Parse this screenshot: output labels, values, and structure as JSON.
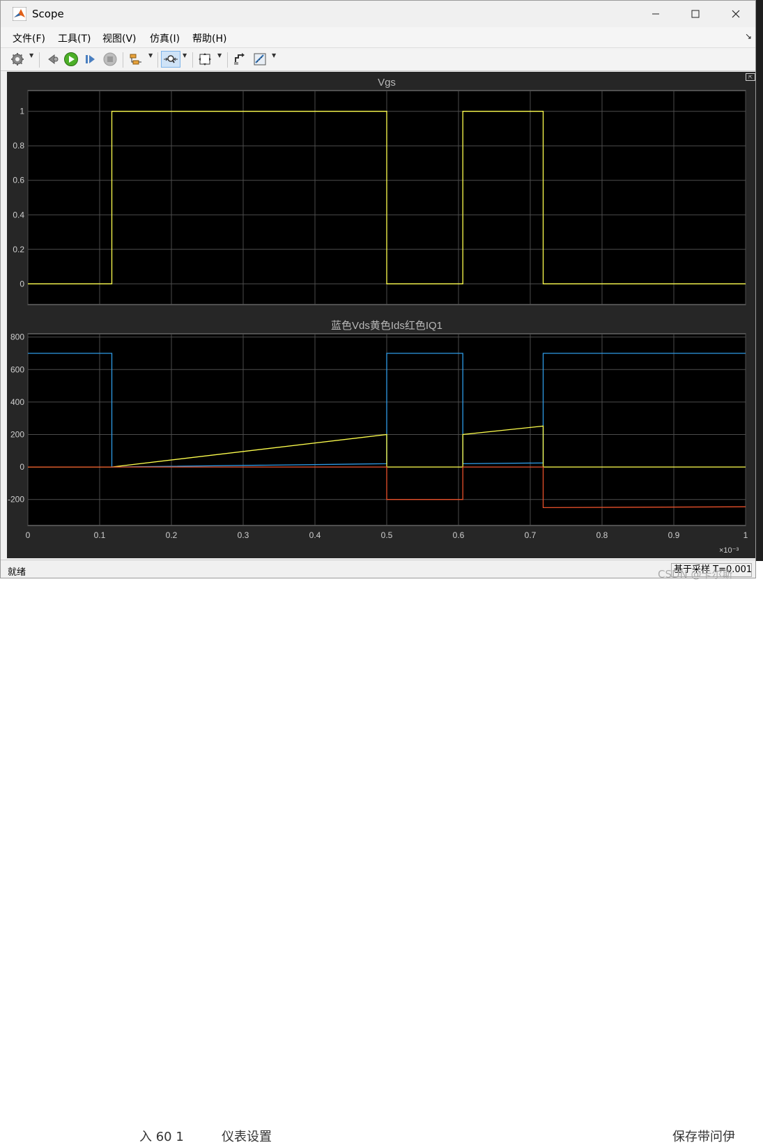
{
  "window": {
    "title": "Scope"
  },
  "menu": [
    {
      "label": "文件(F)"
    },
    {
      "label": "工具(T)"
    },
    {
      "label": "视图(V)"
    },
    {
      "label": "仿真(I)"
    },
    {
      "label": "帮助(H)"
    }
  ],
  "toolbar": {
    "icons": [
      "gear-icon",
      "step-back-icon",
      "run-icon",
      "step-forward-icon",
      "stop-icon",
      "signal-select-icon",
      "zoom-icon",
      "autoscale-icon",
      "highlight-icon",
      "measurement-icon"
    ]
  },
  "status": {
    "left": "就绪",
    "right": "基于采样  T=0.001"
  },
  "watermark": "CSDN @卡尔斯",
  "background_text": {
    "left": "入 60 1",
    "mid": "仪表设置",
    "right": "保存带问伊"
  },
  "colors": {
    "yellow": "#ffff4d",
    "blue": "#2e9be6",
    "red": "#e8502a",
    "grid": "#4d4d4d",
    "axis_text": "#cfcfcf"
  },
  "chart_data": [
    {
      "type": "line",
      "title": "Vgs",
      "xlim": [
        0,
        1
      ],
      "ylim": [
        -0.12,
        1.12
      ],
      "yticks": [
        0,
        0.2,
        0.4,
        0.6,
        0.8,
        1
      ],
      "ytick_labels": [
        "0",
        "0.2",
        "0.4",
        "0.6",
        "0.8",
        "1"
      ],
      "xticks": [
        0,
        0.1,
        0.2,
        0.3,
        0.4,
        0.5,
        0.6,
        0.7,
        0.8,
        0.9,
        1
      ],
      "grid": true,
      "series": [
        {
          "color": "#ffff4d",
          "x": [
            0,
            0.117,
            0.117,
            0.5,
            0.5,
            0.606,
            0.606,
            0.718,
            0.718,
            1
          ],
          "y": [
            0,
            0,
            1,
            1,
            0,
            0,
            1,
            1,
            0,
            0
          ]
        }
      ]
    },
    {
      "type": "line",
      "title": "蓝色Vds黄色Ids红色IQ1",
      "xlim": [
        0,
        1
      ],
      "ylim": [
        -360,
        820
      ],
      "yticks": [
        -200,
        0,
        200,
        400,
        600,
        800
      ],
      "ytick_labels": [
        "-200",
        "0",
        "200",
        "400",
        "600",
        "800"
      ],
      "xticks": [
        0,
        0.1,
        0.2,
        0.3,
        0.4,
        0.5,
        0.6,
        0.7,
        0.8,
        0.9,
        1
      ],
      "xtick_labels": [
        "0",
        "0.1",
        "0.2",
        "0.3",
        "0.4",
        "0.5",
        "0.6",
        "0.7",
        "0.8",
        "0.9",
        "1"
      ],
      "x_multiplier": "×10⁻³",
      "grid": true,
      "series": [
        {
          "color": "#2e9be6",
          "x": [
            0,
            0.117,
            0.117,
            0.5,
            0.5,
            0.606,
            0.606,
            0.718,
            0.718,
            1
          ],
          "y": [
            700,
            700,
            0,
            20,
            700,
            700,
            20,
            25,
            700,
            700
          ]
        },
        {
          "color": "#ffff4d",
          "x": [
            0,
            0.117,
            0.5,
            0.5,
            0.606,
            0.606,
            0.718,
            0.718,
            1
          ],
          "y": [
            0,
            0,
            200,
            0,
            0,
            200,
            252,
            0,
            0
          ]
        },
        {
          "color": "#e8502a",
          "x": [
            0,
            0.5,
            0.5,
            0.606,
            0.606,
            0.718,
            0.718,
            1
          ],
          "y": [
            0,
            0,
            -200,
            -200,
            0,
            0,
            -250,
            -245
          ]
        }
      ]
    }
  ]
}
